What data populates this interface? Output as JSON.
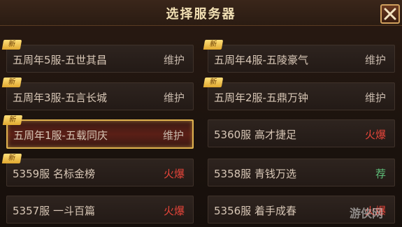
{
  "dialog": {
    "title": "选择服务器",
    "close_icon": "close-x-icon"
  },
  "colors": {
    "maintenance": "#c7b8ab",
    "hot": "#e6453a",
    "recommended": "#5fc07a",
    "selected_border": "#e0b24f"
  },
  "servers": [
    {
      "name": "五周年5服-五世其昌",
      "status": "维护",
      "badge": "新"
    },
    {
      "name": "五周年4服-五陵豪气",
      "status": "维护",
      "badge": "新"
    },
    {
      "name": "五周年3服-五言长城",
      "status": "维护",
      "badge": "新"
    },
    {
      "name": "五周年2服-五鼎万钟",
      "status": "维护",
      "badge": "新"
    },
    {
      "name": "五周年1服-五载同庆",
      "status": "维护",
      "badge": "新",
      "selected": true
    },
    {
      "name": "5360服 高才捷足",
      "status": "火爆"
    },
    {
      "name": "5359服 名标金榜",
      "status": "火爆",
      "badge": "新"
    },
    {
      "name": "5358服 青钱万选",
      "status": "荐"
    },
    {
      "name": "5357服 一斗百篇",
      "status": "火爆"
    },
    {
      "name": "5356服 着手成春",
      "status": "火爆"
    }
  ],
  "watermark": "游侠网"
}
